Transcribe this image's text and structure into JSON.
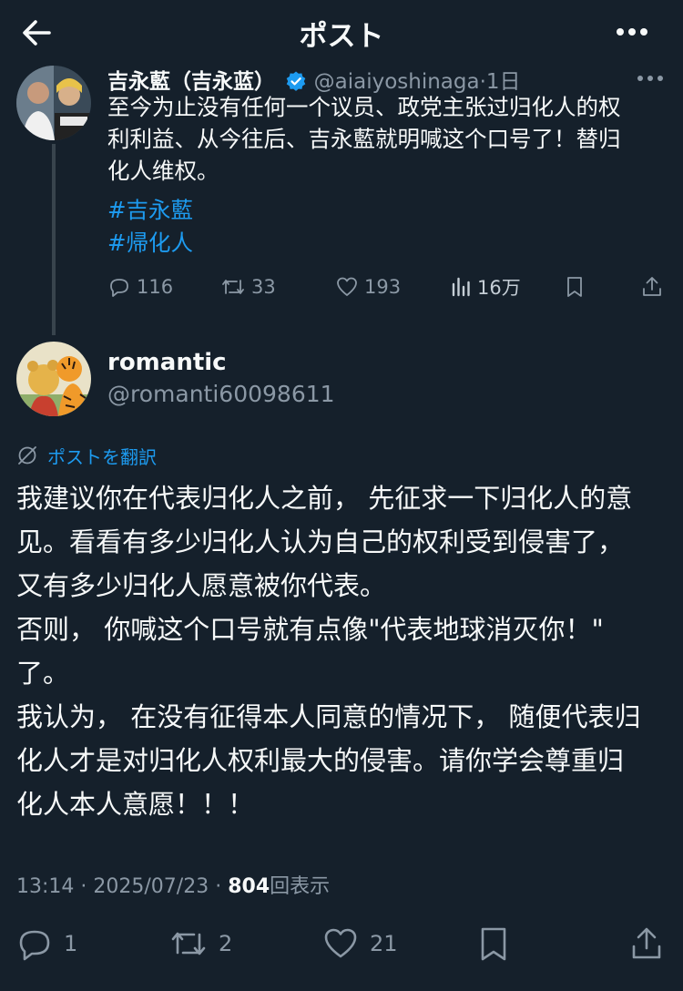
{
  "header": {
    "title": "ポスト"
  },
  "parent": {
    "name": "吉永藍（吉永蓝）",
    "handle": "@aiaiyoshinaga",
    "dot": "·",
    "time": "1日",
    "lines": [
      "至今为止没有任何一个议员、政党主张过归化人的权",
      "利利益、从今往后、吉永藍就明喊这个口号了！替归",
      "化人维权。"
    ],
    "hashtags": [
      "#吉永藍",
      "#帰化人"
    ],
    "actions": {
      "replies": "116",
      "reposts": "33",
      "likes": "193",
      "views": "16万"
    }
  },
  "reply": {
    "name": "romantic",
    "handle": "@romanti60098611",
    "translate_label": "ポストを翻訳",
    "lines": [
      "我建议你在代表归化人之前， 先征求一下归化人的意",
      "见。看看有多少归化人认为自己的权利受到侵害了，",
      "又有多少归化人愿意被你代表。",
      "否则， 你喊这个口号就有点像\"代表地球消灭你！\"",
      "了。",
      "我认为， 在没有征得本人同意的情况下， 随便代表归",
      "化人才是对归化人权利最大的侵害。请你学会尊重归",
      "化人本人意愿！！！"
    ],
    "time": "13:14",
    "sep": "·",
    "date": "2025/07/23",
    "views_count": "804",
    "views_label": "回表示",
    "actions": {
      "replies": "1",
      "reposts": "2",
      "likes": "21"
    }
  },
  "colors": {
    "background": "#15202b",
    "text": "#f7f9f9",
    "muted": "#8b98a5",
    "accent": "#1d9bf0",
    "line": "#38444d"
  },
  "icons": [
    "back-arrow-icon",
    "more-icon",
    "verified-badge-icon",
    "reply-icon",
    "repost-icon",
    "like-icon",
    "views-icon",
    "bookmark-icon",
    "share-icon",
    "translate-icon"
  ]
}
